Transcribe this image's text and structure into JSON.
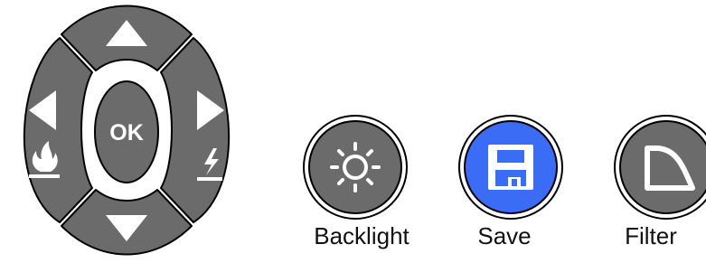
{
  "dpad": {
    "ok_label": "OK",
    "up_icon": "triangle-up",
    "down_icon": "triangle-down",
    "left_icon": "triangle-left",
    "right_icon": "triangle-right",
    "left_sub_icon": "flame",
    "right_sub_icon": "lightning"
  },
  "buttons": [
    {
      "label": "Backlight",
      "icon": "sun-icon",
      "active": false
    },
    {
      "label": "Save",
      "icon": "floppy-disk-icon",
      "active": true
    },
    {
      "label": "Filter",
      "icon": "filter-curve-icon",
      "active": false
    }
  ],
  "colors": {
    "button_gray": "#6b6b6b",
    "active_blue": "#3a6cf6",
    "outline": "#000000",
    "icon": "#ffffff"
  }
}
